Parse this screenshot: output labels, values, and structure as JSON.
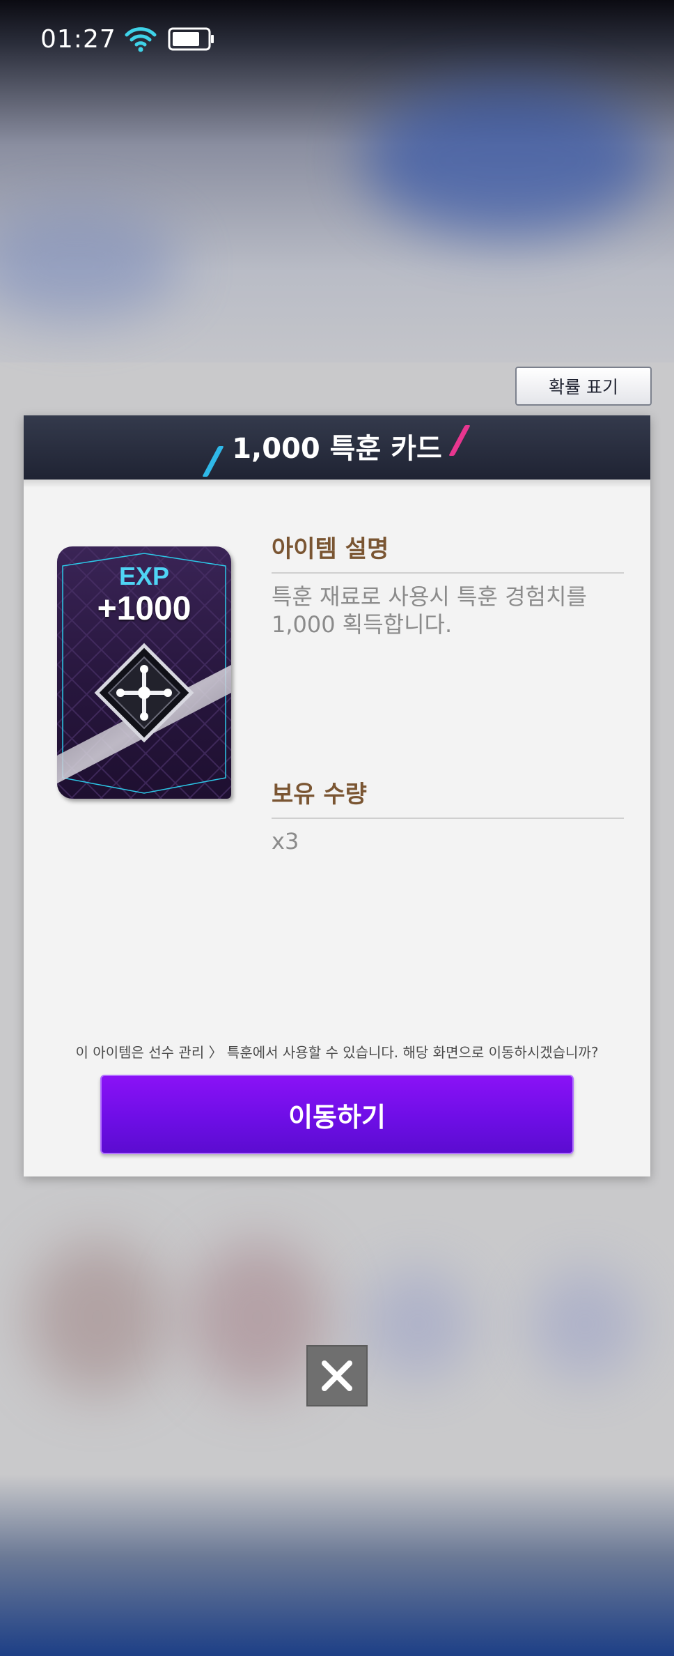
{
  "status_bar": {
    "time": "01:27",
    "wifi_icon": "wifi-icon",
    "battery_icon": "battery-icon"
  },
  "probability_button": {
    "label": "확률 표기"
  },
  "dialog": {
    "title": "1,000 특훈 카드",
    "card": {
      "exp_label": "EXP",
      "exp_value": "+1000",
      "emblem_icon": "training-emblem-icon"
    },
    "description": {
      "heading": "아이템 설명",
      "text": "특훈 재료로 사용시 특훈 경험치를 1,000 획득합니다."
    },
    "quantity": {
      "heading": "보유 수량",
      "value": "x3"
    },
    "notice": "이 아이템은 선수 관리 〉 특훈에서 사용할 수 있습니다. 해당 화면으로 이동하시겠습니까?",
    "go_button": {
      "label": "이동하기"
    }
  },
  "close_button": {
    "icon": "close-icon"
  },
  "colors": {
    "header_bg": "#262a3a",
    "accent_cyan": "#2fb8e8",
    "accent_pink": "#e8368f",
    "section_title": "#7a5532",
    "button_purple": "#7a10ee"
  }
}
